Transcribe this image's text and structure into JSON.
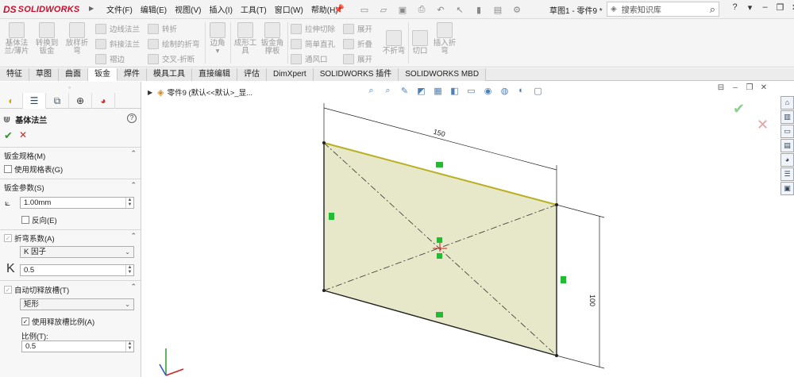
{
  "app": {
    "logo_ds": "DS",
    "logo_name": "SOLIDWORKS",
    "doc_title": "草图1 - 零件9 *",
    "search_placeholder": "搜索知识库"
  },
  "menus": [
    "文件(F)",
    "编辑(E)",
    "视图(V)",
    "插入(I)",
    "工具(T)",
    "窗口(W)",
    "帮助(H)"
  ],
  "ribbon": {
    "big_buttons": [
      {
        "label1": "基体法",
        "label2": "兰/薄片"
      },
      {
        "label1": "转换到",
        "label2": "钣金"
      },
      {
        "label1": "放样折",
        "label2": "弯"
      }
    ],
    "small_col1": [
      "边线法兰",
      "斜接法兰",
      "褶边"
    ],
    "small_col2": [
      "转折",
      "绘制的折弯",
      "交叉-折断"
    ],
    "corner": "边角",
    "forming_tool1": "成形工",
    "forming_tool2": "具",
    "gusset1": "钣金角",
    "gusset2": "撑板",
    "small_col3": [
      "拉伸切除",
      "简单直孔",
      "通风口"
    ],
    "unfold": "展开",
    "fold": "折叠",
    "flatten": "展开",
    "no_bends": "不折弯",
    "rip": "切口",
    "insert_bends1": "插入折",
    "insert_bends2": "弯"
  },
  "tabs": [
    "特征",
    "草图",
    "曲面",
    "钣金",
    "焊件",
    "模具工具",
    "直接编辑",
    "评估",
    "DimXpert",
    "SOLIDWORKS 插件",
    "SOLIDWORKS MBD"
  ],
  "active_tab": "钣金",
  "panel": {
    "title": "基体法兰",
    "help": "?",
    "sections": {
      "gauge": "钣金规格(M)",
      "use_gauge": "使用规格表(G)",
      "params": "钣金参数(S)",
      "thickness": "1.00mm",
      "reverse": "反向(E)",
      "bend_allowance": "折弯系数(A)",
      "bend_type": "K 因子",
      "k_symbol": "K",
      "k_value": "0.5",
      "auto_relief": "自动切释放槽(T)",
      "relief_type": "矩形",
      "use_relief_ratio": "使用释放槽比例(A)",
      "ratio_label": "比例(T):",
      "ratio_value": "0.5"
    }
  },
  "viewport": {
    "tree_label": "零件9 (默认<<默认>_显..."
  },
  "sketch": {
    "width_dim": "150",
    "height_dim": "100",
    "fill_color": "#e6e6c8",
    "line_color": "#222222",
    "edge_color": "#8a8a2a"
  }
}
